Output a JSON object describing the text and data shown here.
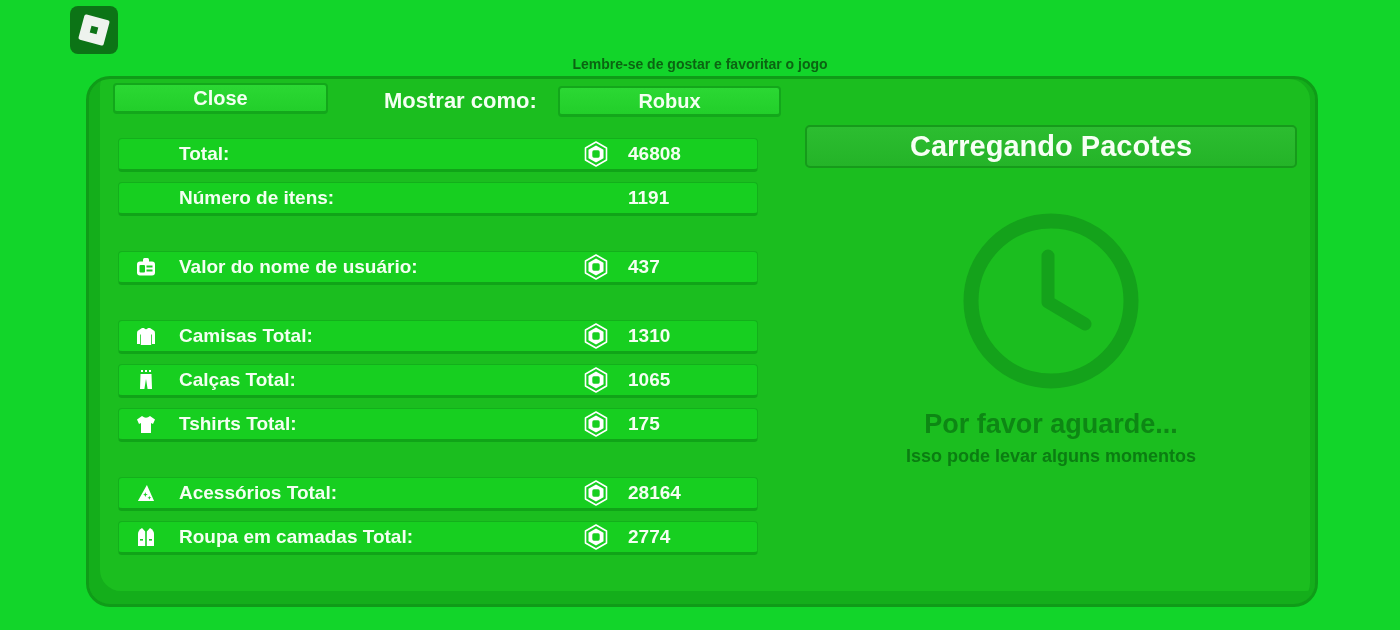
{
  "hint": "Lembre-se de gostar e favoritar o jogo",
  "toolbar": {
    "close_button": "Close",
    "display_label": "Mostrar como:",
    "display_button": "Robux"
  },
  "stats": [
    {
      "rows": [
        {
          "kind": "plain",
          "label": "Total:",
          "currency": true,
          "value": "46808"
        },
        {
          "kind": "plain",
          "label": "Número de itens:",
          "currency": false,
          "value": "1191"
        }
      ]
    },
    {
      "rows": [
        {
          "kind": "username",
          "label": "Valor do nome de usuário:",
          "currency": true,
          "value": "437"
        }
      ]
    },
    {
      "rows": [
        {
          "kind": "shirts",
          "label": "Camisas Total:",
          "currency": true,
          "value": "1310"
        },
        {
          "kind": "pants",
          "label": "Calças Total:",
          "currency": true,
          "value": "1065"
        },
        {
          "kind": "tshirts",
          "label": "Tshirts Total:",
          "currency": true,
          "value": "175"
        }
      ]
    },
    {
      "rows": [
        {
          "kind": "accessories",
          "label": "Acessórios Total:",
          "currency": true,
          "value": "28164"
        },
        {
          "kind": "layered",
          "label": "Roupa em camadas Total:",
          "currency": true,
          "value": "2774"
        }
      ]
    }
  ],
  "loading": {
    "title": "Carregando Pacotes",
    "message": "Por favor aguarde...",
    "detail": "Isso pode levar alguns momentos"
  }
}
